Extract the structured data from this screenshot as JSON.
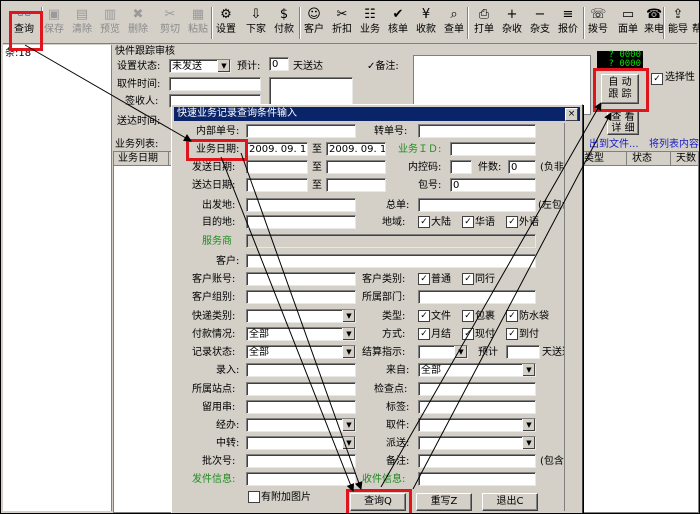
{
  "toolbar": {
    "items": [
      {
        "label": "查询",
        "icon": "binoculars-icon"
      },
      {
        "label": "保存",
        "icon": "save-icon"
      },
      {
        "label": "清除",
        "icon": "clear-icon"
      },
      {
        "label": "预览",
        "icon": "preview-icon"
      },
      {
        "label": "删除",
        "icon": "delete-icon"
      },
      {
        "label": "剪切",
        "icon": "cut-icon"
      },
      {
        "label": "粘贴",
        "icon": "paste-icon"
      },
      {
        "label": "设置",
        "icon": "settings-icon"
      },
      {
        "label": "下家",
        "icon": "next-icon"
      },
      {
        "label": "付款",
        "icon": "payment-icon"
      },
      {
        "label": "客户",
        "icon": "customer-icon"
      },
      {
        "label": "折扣",
        "icon": "discount-icon"
      },
      {
        "label": "业务",
        "icon": "business-icon"
      },
      {
        "label": "核单",
        "icon": "check-order-icon"
      },
      {
        "label": "收款",
        "icon": "receipt-icon"
      },
      {
        "label": "查单",
        "icon": "find-order-icon"
      },
      {
        "label": "打单",
        "icon": "print-icon"
      },
      {
        "label": "杂收",
        "icon": "misc-income-icon"
      },
      {
        "label": "杂支",
        "icon": "misc-expense-icon"
      },
      {
        "label": "报价",
        "icon": "quote-icon"
      },
      {
        "label": "拨号",
        "icon": "dial-icon"
      },
      {
        "label": "面单",
        "icon": "waybill-icon"
      },
      {
        "label": "来电",
        "icon": "phone-icon"
      },
      {
        "label": "能导",
        "icon": "export-icon"
      },
      {
        "label": "帮助",
        "icon": "help-icon"
      }
    ]
  },
  "left_panel": {
    "count_text": "条:18"
  },
  "tracking_panel": {
    "title": "快件跟踪审核",
    "status_label": "设置状态:",
    "status_value": "未发送",
    "expected_label": "预计:",
    "expected_value": "0",
    "days_label": "天送达",
    "remark_label": "✓备注:",
    "pickup_label": "取件时间:",
    "signer_label": "签收人:",
    "delivery_label": "送达时间:",
    "list_label": "业务列表:",
    "col_date": "业务日期",
    "col_type": "类型",
    "col_status": "状态",
    "col_days": "天数"
  },
  "right_panel": {
    "digits_1": "0000",
    "digits_2": "0000",
    "auto_track_1": "自 动",
    "auto_track_2": "跟 踪",
    "select_label": "选择性",
    "view_1": "查 看",
    "view_2": "详 细",
    "link_export": "出到文件...",
    "link_list": "将列表内容"
  },
  "dialog": {
    "title": "快速业务记录查询条件输入",
    "close": "×",
    "internal_no_label": "内部单号:",
    "transfer_no_label": "转单号:",
    "biz_date_label": "业务日期:",
    "biz_date_from": "2009. 09. 12",
    "to1": "至",
    "biz_date_to": "2009. 09. 12",
    "biz_id_label": "业务ＩＤ:",
    "send_date_label": "发送日期:",
    "to2": "至",
    "internal_code_label": "内控码:",
    "pieces_label": "件数:",
    "pieces_value": "0",
    "negative_label": "(负非)",
    "deliver_date_label": "送达日期:",
    "to3": "至",
    "package_label": "包号:",
    "package_value": "0",
    "origin_label": "出发地:",
    "master_label": "总单:",
    "master_suffix": "(左包含)",
    "dest_label": "目的地:",
    "region_label": "地域:",
    "region_1": "大陆",
    "region_2": "华语",
    "region_3": "外语",
    "provider_label": "服务商",
    "customer_label": "客户:",
    "account_label": "客户账号:",
    "cust_type_label": "客户类别:",
    "cust_type_1": "普通",
    "cust_type_2": "同行",
    "group_label": "客户组别:",
    "dept_label": "所属部门:",
    "express_type_label": "快递类别:",
    "kind_label": "类型:",
    "kind_1": "文件",
    "kind_2": "包裹",
    "kind_3": "防水袋",
    "payment_label": "付款情况:",
    "payment_value": "全部",
    "method_label": "方式:",
    "method_1": "月结",
    "method_2": "现付",
    "method_3": "到付",
    "record_status_label": "记录状态:",
    "record_status_value": "全部",
    "settle_label": "结算指示:",
    "settle_expected_label": "预计",
    "settle_days_label": "天送达",
    "entry_label": "录入:",
    "source_label": "来自:",
    "source_value": "全部",
    "site_label": "所属站点:",
    "checkpoint_label": "检查点:",
    "reserve_label": "留用串:",
    "tag_label": "标签:",
    "handler_label": "经办:",
    "pickup_label": "取件:",
    "transit_label": "中转:",
    "dispatch_label": "派送:",
    "batch_label": "批次号:",
    "remark_label": "备注:",
    "contains_label": "(包含)",
    "sender_label": "发件信息:",
    "receiver_label": "收件信息:",
    "attach_label": "有附加图片",
    "query_btn": "查询Q",
    "reset_btn": "重写Z",
    "exit_btn": "退出C"
  }
}
